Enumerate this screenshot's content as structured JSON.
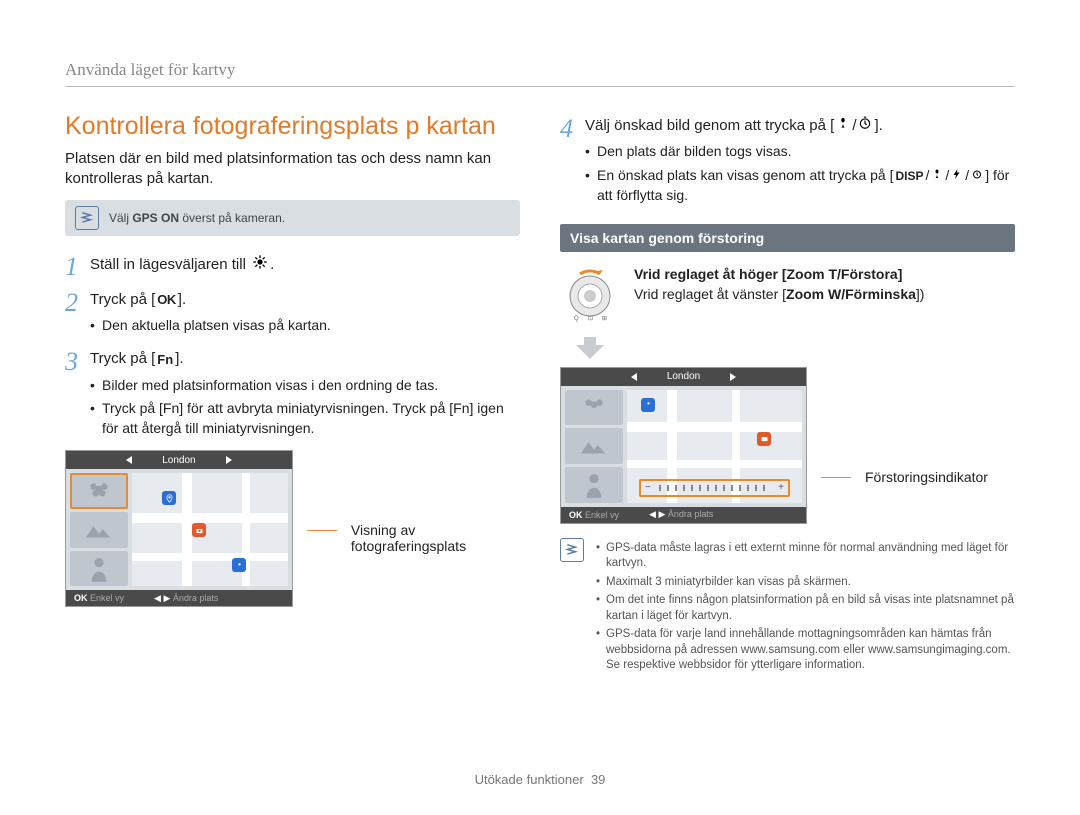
{
  "header": {
    "running_head": "Använda läget för kartvy"
  },
  "left": {
    "title": "Kontrollera fotograferingsplats p  kartan",
    "intro": "Platsen där en bild med platsinformation tas och dess namn kan kontrolleras på kartan.",
    "note1": {
      "prefix": "Välj ",
      "bold": "GPS ON",
      "suffix": " överst på kameran."
    },
    "step1": {
      "num": "1",
      "text_pre": "Ställ in lägesväljaren till ",
      "text_post": "."
    },
    "step2": {
      "num": "2",
      "text_pre": "Tryck på [",
      "kbd": "OK",
      "text_post": "].",
      "bullets": [
        "Den aktuella platsen visas på kartan."
      ]
    },
    "step3": {
      "num": "3",
      "text_pre": "Tryck på [",
      "kbd": "Fn",
      "text_post": "].",
      "bullets": [
        "Bilder med platsinformation visas i den ordning de tas.",
        "Tryck på [Fn] för att avbryta miniatyrvisningen. Tryck på [Fn] igen för att återgå till miniatyrvisningen."
      ]
    },
    "screenshot": {
      "title": "London",
      "bottom_left": "Enkel vy",
      "bottom_right": "Ändra plats",
      "callout": "Visning av fotograferingsplats"
    }
  },
  "right": {
    "step4": {
      "num": "4",
      "text_pre": "Välj önskad bild genom att trycka på [",
      "text_post": "].",
      "bullets": [
        "Den plats där bilden togs visas.",
        "En önskad plats kan visas genom att trycka på [DISP/ / / ] för att förflytta sig."
      ]
    },
    "section_title": "Visa kartan genom förstoring",
    "dial": {
      "line1_pre": "Vrid reglaget åt höger [",
      "line1_bold": "Zoom T/Förstora",
      "line1_post": "]",
      "line2_pre": "Vrid reglaget åt vänster [",
      "line2_bold": "Zoom W/Förminska",
      "line2_post": "])"
    },
    "screenshot": {
      "title": "London",
      "bottom_left": "Enkel vy",
      "bottom_right": "Ändra plats",
      "callout": "Förstoringsindikator"
    },
    "notes": [
      "GPS-data måste lagras i ett externt minne för normal användning med läget för kartvyn.",
      "Maximalt 3 miniatyrbilder kan visas på skärmen.",
      "Om det inte finns någon platsinformation på en bild så visas inte platsnamnet på kartan i läget för kartvyn.",
      "GPS-data för varje land innehållande mottagningsområden kan hämtas från webbsidorna på adressen www.samsung.com eller www.samsungimaging.com. Se respektive webbsidor för ytterligare information."
    ]
  },
  "footer": {
    "section": "Utökade funktioner",
    "page": "39"
  }
}
